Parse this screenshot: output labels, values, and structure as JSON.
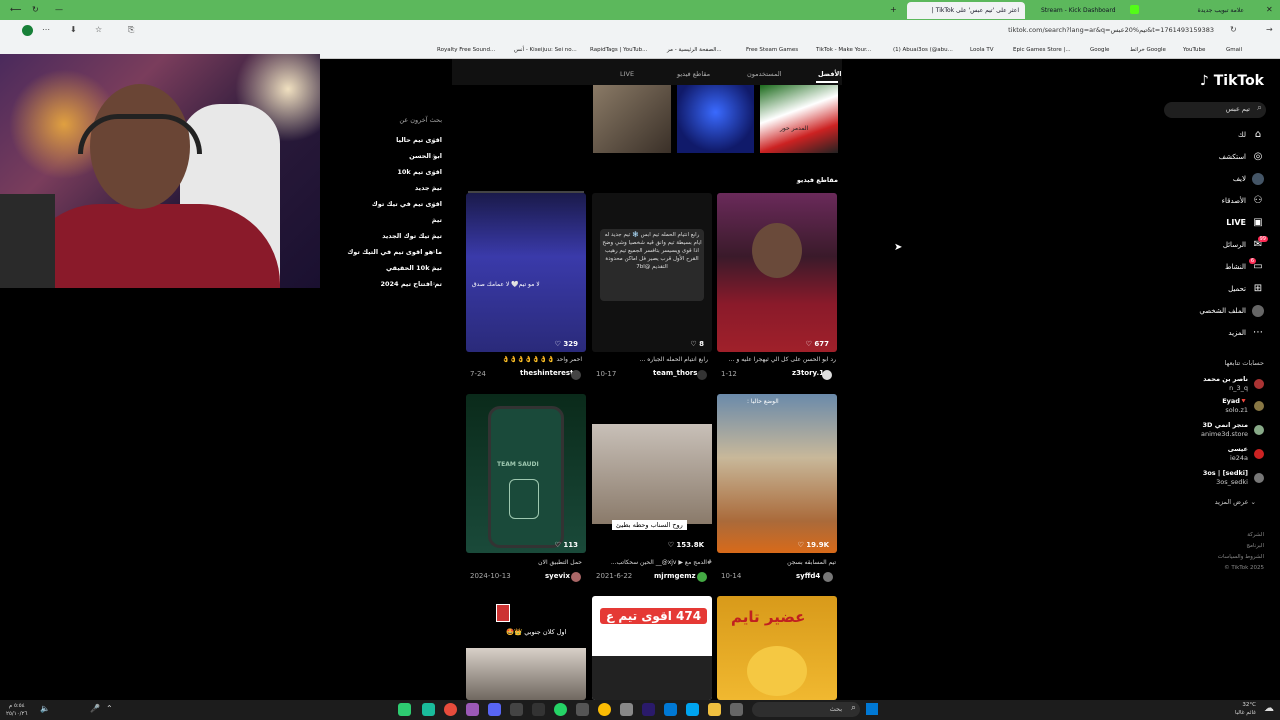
{
  "browser": {
    "tabs": [
      {
        "label": "علامة تبويب جديدة",
        "active": false
      },
      {
        "label": "Stream - Kick Dashboard",
        "active": false
      },
      {
        "label": "اعثر على 'تيم عبس' على TikTok |",
        "active": true
      }
    ],
    "url": "tiktok.com/search?lang=ar&q=تيم%20عبس&t=1761493159383",
    "bookmarks": [
      "Gmail",
      "YouTube",
      "خرائط Google",
      "Google",
      "Epic Games Store |...",
      "(1) Abuai3os (@abu...",
      "Loola TV",
      "TikTok - Make Your...",
      "Free Steam Games",
      "الصفحة الرئيسية - مر...",
      "RapidTags | YouTub...",
      "أنس - Kiseijuu: Sei no...",
      "Royalty Free Sound..."
    ]
  },
  "tiktok": {
    "logo": "TikTok",
    "search_placeholder": "تيم عبس",
    "nav": [
      {
        "label": "لك",
        "icon": "home-icon"
      },
      {
        "label": "استكشف",
        "icon": "compass-icon"
      },
      {
        "label": "لايف",
        "icon": "live-avatar-icon"
      },
      {
        "label": "الأصدقاء",
        "icon": "friends-icon"
      },
      {
        "label": "LIVE",
        "icon": "live-tv-icon"
      },
      {
        "label": "الرسائل",
        "icon": "messages-icon",
        "badge": "99"
      },
      {
        "label": "النشاط",
        "icon": "activity-icon",
        "badge": "6"
      },
      {
        "label": "تحميل",
        "icon": "upload-icon"
      },
      {
        "label": "الملف الشخصي",
        "icon": "profile-icon"
      },
      {
        "label": "المزيد",
        "icon": "more-icon"
      }
    ],
    "following_title": "حسابات تتابعها",
    "following": [
      {
        "name": "ناصر بن محمد",
        "handle": "n_3_q"
      },
      {
        "name": "Eyad🔻",
        "handle": "solo.z1"
      },
      {
        "name": "متجر انمي 3D",
        "handle": "anime3d.store"
      },
      {
        "name": "عيسى",
        "handle": "ie24a"
      },
      {
        "name": "3os | [sedki]",
        "handle": "3os_sedki"
      }
    ],
    "see_more": "عرض المزيد",
    "footer": [
      "الشركة",
      "البرنامج",
      "الشروط والسياسات",
      "TikTok 2025 ©"
    ],
    "tabs": [
      "الأفضل",
      "المستخدمون",
      "مقاطع فيديو",
      "LIVE"
    ],
    "videos_title": "مقاطع فيديو",
    "top_thumb_caption": "المدمر حور",
    "related_title": "بحث آخرون عن",
    "related": [
      "اقوى تيم حاليا",
      "ابو الحسن",
      "اقوى تيم 10k",
      "تيم جديد",
      "اقوى تيم في تيك توك",
      "تيم",
      "تيم تيك توك الجديد",
      "ما هو اقوى تيم في التيك توك",
      "تيم 10k الحقيقي",
      "تم افتتاح تيم 2024"
    ],
    "cards": [
      {
        "likes": "677",
        "caption": "رد ابو الحسن على كل الي ثيهجرا عليه و ...",
        "author": "z3tory.1",
        "date": "1-12"
      },
      {
        "likes": "8",
        "caption": "رابع انتيام الحمله الجباره ...",
        "author": "team_thors",
        "date": "10-17",
        "overlay": "رابع انتيام الحمله تيم ابس ❄️ تيم جديد له ايام بسيطة تيم وانق قيه شخصيا وشي وضح اذا قوى ويسيسر بتافسر الجميع تيم رهيب القرح الأول قرب يصير فل اماكن محدودة التقديم @7bl"
      },
      {
        "likes": "329",
        "caption": "احمر واحد 👌👌👌👌👌👌👌",
        "author": "theshinterest",
        "date": "7-24",
        "overlay": "لا مو تيم🤍 لا عمامك صدق"
      },
      {
        "likes": "19.9K",
        "caption": "تيم المسابقه بسجن",
        "author": "syffd4",
        "date": "10-14",
        "overlay": "الوضع حاليا :"
      },
      {
        "likes": "153.8K",
        "caption": "#الدمج مع ▶ xjv@__ الحين سحكاتب...",
        "author": "mjrmgemz",
        "date": "2021-6-22",
        "overlay": "روح السناب وحطه بطيئ"
      },
      {
        "likes": "113",
        "caption": "حمل التطبيق الان",
        "author": "syevix",
        "date": "2024-10-13",
        "overlay": "TEAM SAUDI"
      },
      {
        "likes": "",
        "caption": "",
        "author": "",
        "date": "",
        "overlay": "عضير تايم"
      },
      {
        "likes": "",
        "caption": "",
        "author": "",
        "date": "",
        "overlay": "474 اقوى تيم ع"
      },
      {
        "likes": "",
        "caption": "",
        "author": "",
        "date": "",
        "overlay": "اول كلان جنوبي 👑🤩"
      }
    ]
  },
  "taskbar": {
    "search_label": "بحث",
    "weather_temp": "32°C",
    "weather_text": "غائم غالبا",
    "time": "٥:٥٤ م",
    "date": "٢٥/١٠/٢٦"
  }
}
